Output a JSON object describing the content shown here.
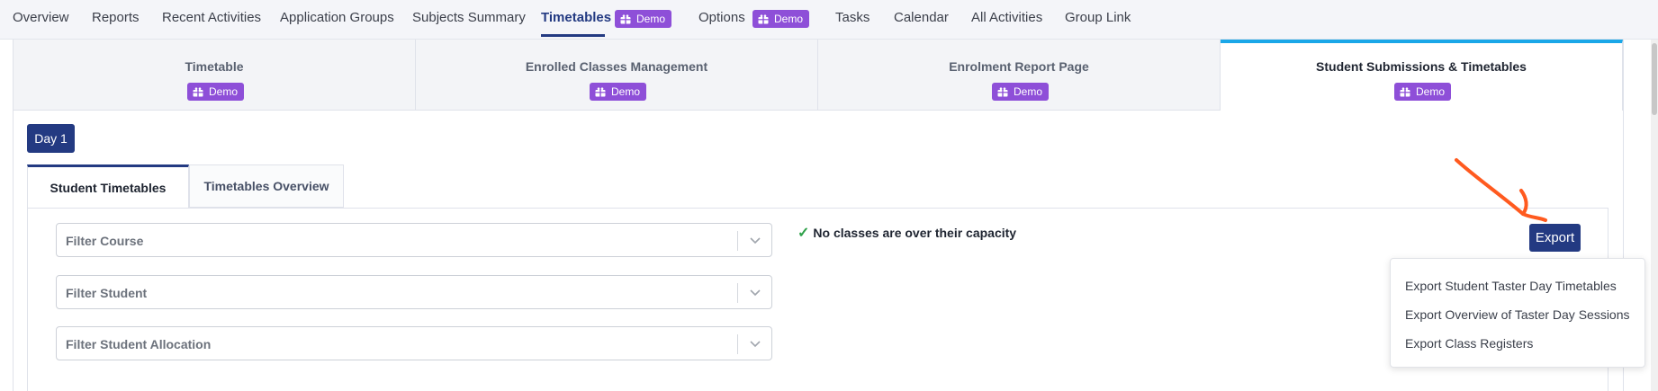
{
  "nav": {
    "items": [
      {
        "label": "Overview"
      },
      {
        "label": "Reports"
      },
      {
        "label": "Recent Activities"
      },
      {
        "label": "Application Groups"
      },
      {
        "label": "Subjects Summary"
      },
      {
        "label": "Timetables"
      },
      {
        "label": "Options"
      },
      {
        "label": "Tasks"
      },
      {
        "label": "Calendar"
      },
      {
        "label": "All Activities"
      },
      {
        "label": "Group Link"
      }
    ],
    "badge_label": "Demo"
  },
  "subtabs": [
    {
      "label": "Timetable",
      "badge": "Demo"
    },
    {
      "label": "Enrolled Classes Management",
      "badge": "Demo"
    },
    {
      "label": "Enrolment Report Page",
      "badge": "Demo"
    },
    {
      "label": "Student Submissions & Timetables",
      "badge": "Demo"
    }
  ],
  "day_button": "Day 1",
  "inner_tabs": [
    {
      "label": "Student Timetables"
    },
    {
      "label": "Timetables Overview"
    }
  ],
  "filters": [
    {
      "placeholder": "Filter Course"
    },
    {
      "placeholder": "Filter Student"
    },
    {
      "placeholder": "Filter Student Allocation"
    }
  ],
  "status": {
    "check": "✓",
    "text": "No classes are over their capacity"
  },
  "export": {
    "button": "Export",
    "menu": [
      "Export Student Taster Day Timetables",
      "Export Overview of Taster Day Sessions",
      "Export Class Registers"
    ]
  },
  "colors": {
    "primary": "#233a82",
    "badge": "#8e4fd8",
    "active_tab_border": "#1aa7e8",
    "check": "#2fa14a",
    "annotation_arrow": "#ff5a1f"
  }
}
